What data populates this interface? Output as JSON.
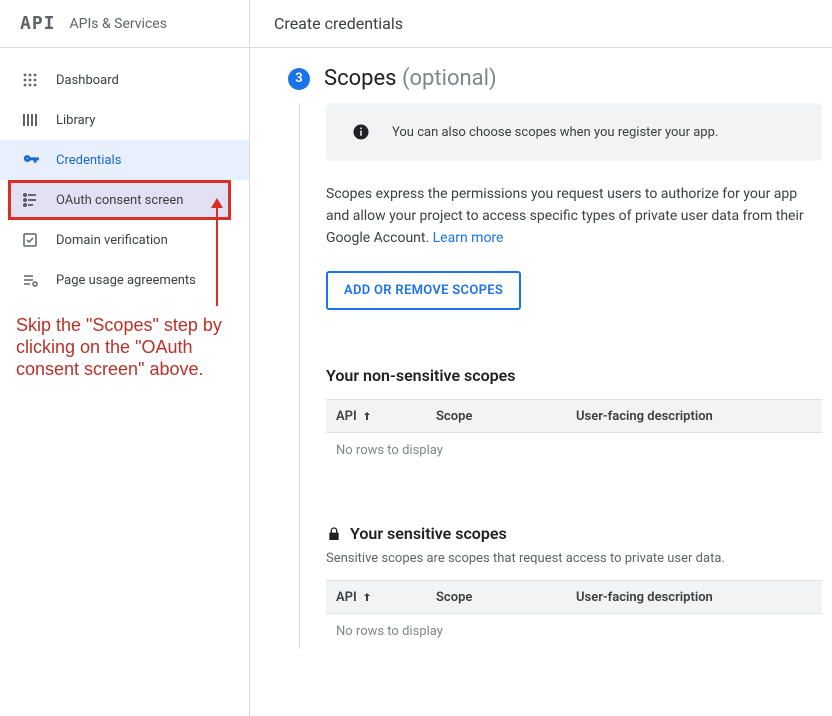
{
  "sidebar": {
    "logo": "API",
    "title": "APIs & Services",
    "items": [
      {
        "label": "Dashboard"
      },
      {
        "label": "Library"
      },
      {
        "label": "Credentials"
      },
      {
        "label": "OAuth consent screen"
      },
      {
        "label": "Domain verification"
      },
      {
        "label": "Page usage agreements"
      }
    ]
  },
  "callout": "Skip the \"Scopes\" step by clicking on the \"OAuth consent screen\" above.",
  "main": {
    "header": "Create credentials",
    "step": {
      "num": "3",
      "title": "Scopes",
      "subtitle": "(optional)"
    },
    "banner": "You can also choose scopes when you register your app.",
    "desc_text": "Scopes express the permissions you request users to authorize for your app and allow your project to access specific types of private user data from their Google Account. ",
    "learn_more": "Learn more",
    "button": "ADD OR REMOVE SCOPES",
    "table_headers": {
      "api": "API",
      "scope": "Scope",
      "desc": "User-facing description"
    },
    "empty": "No rows to display",
    "sections": {
      "nonsensitive": {
        "title": "Your non-sensitive scopes"
      },
      "sensitive": {
        "title": "Your sensitive scopes",
        "desc": "Sensitive scopes are scopes that request access to private user data."
      }
    }
  }
}
